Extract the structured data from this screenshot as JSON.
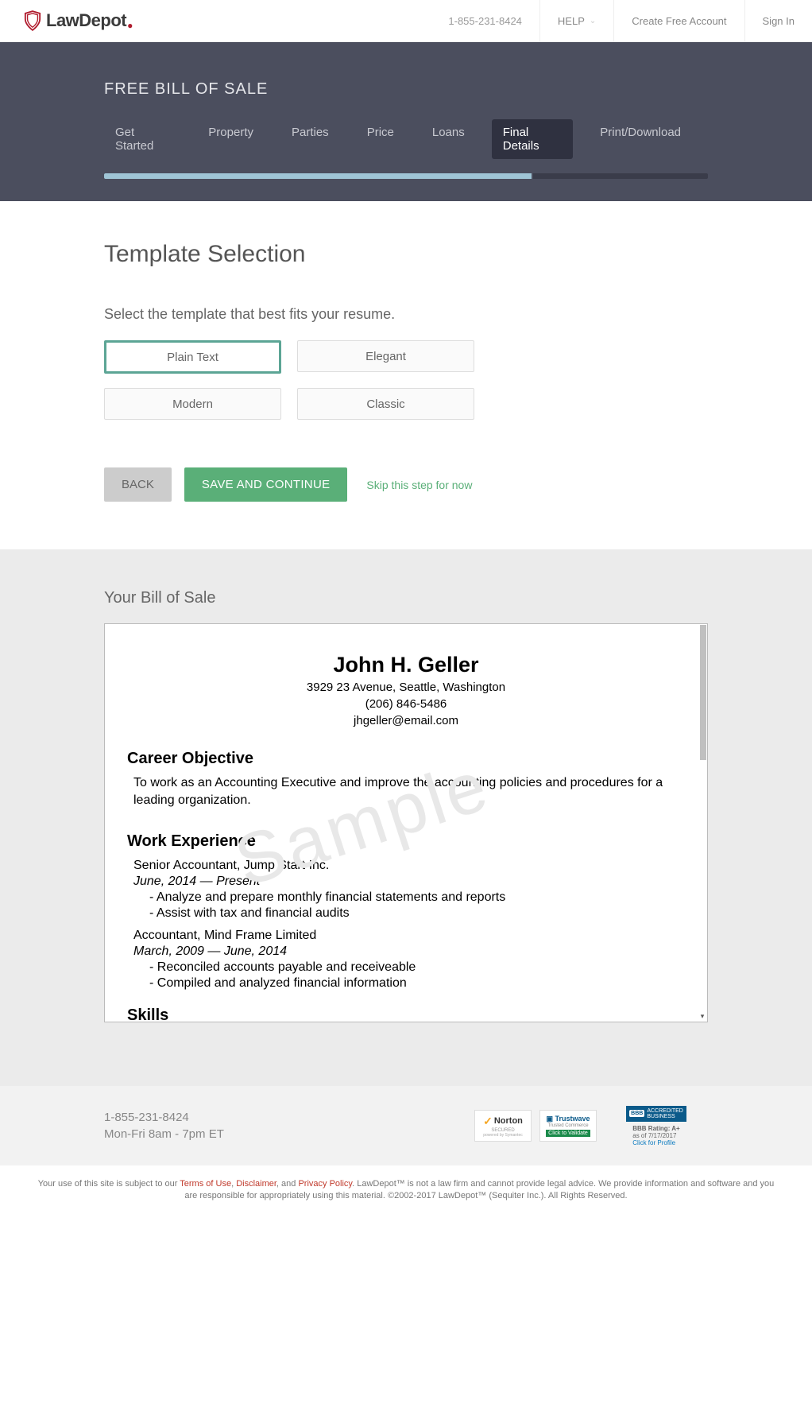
{
  "header": {
    "logo_text": "LawDepot",
    "phone": "1-855-231-8424",
    "help": "HELP",
    "create": "Create Free Account",
    "signin": "Sign In"
  },
  "band": {
    "title": "FREE BILL OF SALE",
    "tabs": [
      "Get Started",
      "Property",
      "Parties",
      "Price",
      "Loans",
      "Final Details",
      "Print/Download"
    ],
    "active_tab": "Final Details"
  },
  "main": {
    "title": "Template Selection",
    "subtitle": "Select the template that best fits your resume.",
    "templates": [
      "Plain Text",
      "Elegant",
      "Modern",
      "Classic"
    ],
    "selected": "Plain Text",
    "back": "BACK",
    "save": "SAVE AND CONTINUE",
    "skip": "Skip this step for now"
  },
  "preview": {
    "title": "Your Bill of Sale",
    "watermark": "Sample",
    "name": "John H. Geller",
    "address": "3929 23 Avenue, Seattle, Washington",
    "phone": "(206) 846-5486",
    "email": "jhgeller@email.com",
    "h_obj": "Career Objective",
    "objective": "To work as an Accounting Executive and improve the accounting policies and procedures for a leading organization.",
    "h_work": "Work Experience",
    "job1_title": "Senior Accountant, Jump Start Inc.",
    "job1_dates": "June, 2014 — Present",
    "job1_b1": "-  Analyze and prepare monthly financial statements and reports",
    "job1_b2": "-  Assist with tax and financial audits",
    "job2_title": "Accountant, Mind Frame Limited",
    "job2_dates": "March, 2009 — June, 2014",
    "job2_b1": "-  Reconciled accounts payable and receiveable",
    "job2_b2": "-  Compiled and analyzed financial information",
    "h_skills": "Skills"
  },
  "footer": {
    "phone": "1-855-231-8424",
    "hours": "Mon-Fri 8am - 7pm ET",
    "norton1": "Norton",
    "norton2": "SECURED",
    "norton3": "powered by Symantec",
    "trust1": "Trustwave",
    "trust2": "Trusted Commerce",
    "trust3": "Click to Validate",
    "bbb1": "ACCREDITED",
    "bbb2": "BUSINESS",
    "bbb_r1": "BBB Rating: A+",
    "bbb_r2": "as of 7/17/2017",
    "bbb_r3": "Click for Profile",
    "legal_pre": "Your use of this site is subject to our ",
    "legal_terms": "Terms of Use",
    "legal_disc": "Disclaimer",
    "legal_and": ", and ",
    "legal_priv": "Privacy Policy",
    "legal_rest": ". LawDepot™ is not a law firm and cannot provide legal advice. We provide information and software and you are responsible for appropriately using this material. ©2002-2017 LawDepot™ (Sequiter Inc.). All Rights Reserved."
  }
}
